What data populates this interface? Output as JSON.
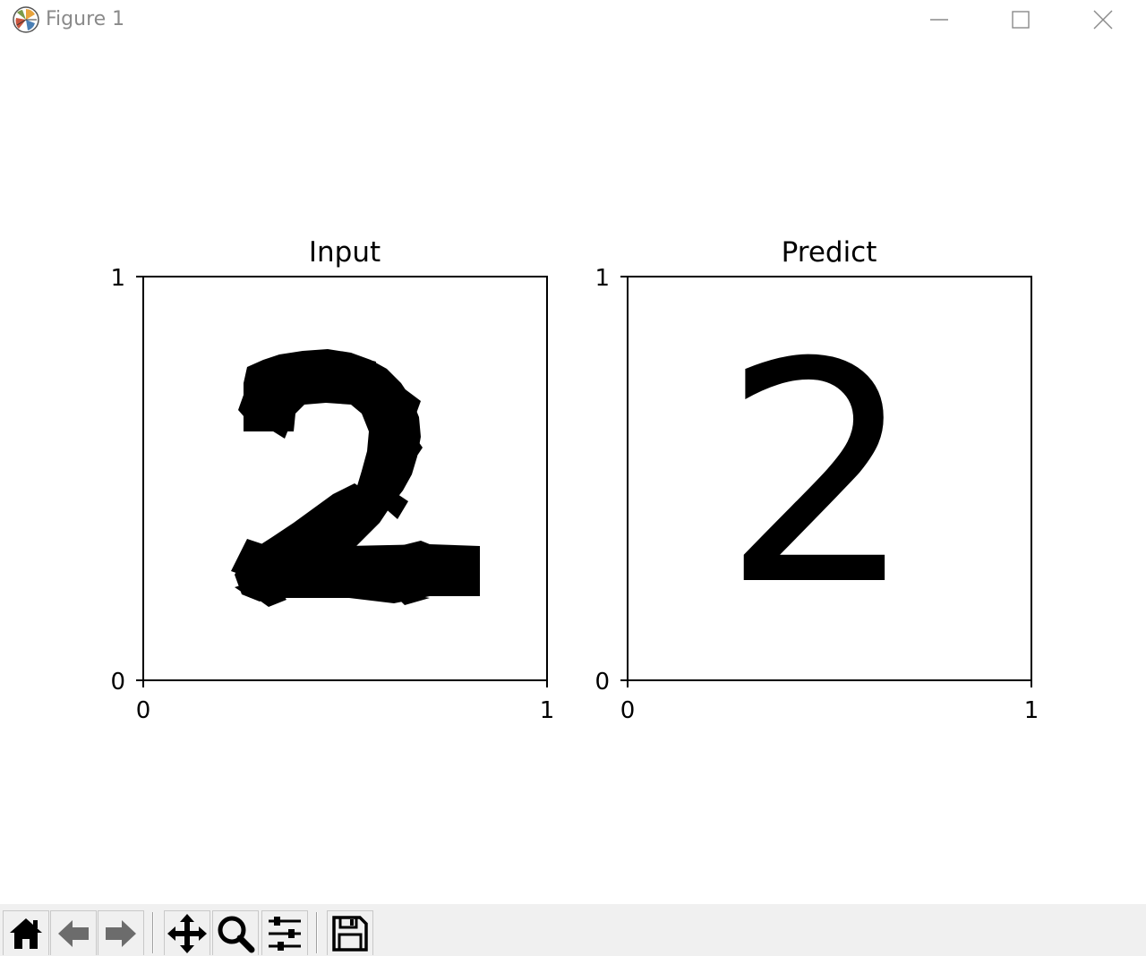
{
  "window": {
    "title": "Figure 1",
    "app_icon": "matplotlib-icon"
  },
  "figure": {
    "axes": [
      {
        "title": "Input",
        "x_ticks": [
          "0",
          "1"
        ],
        "y_ticks": [
          "0",
          "1"
        ],
        "content": "hand-drawn digit image"
      },
      {
        "title": "Predict",
        "x_ticks": [
          "0",
          "1"
        ],
        "y_ticks": [
          "0",
          "1"
        ],
        "content": "predicted digit text",
        "predicted_digit": "2"
      }
    ]
  },
  "toolbar": {
    "buttons": [
      {
        "name": "home-button",
        "icon": "home-icon"
      },
      {
        "name": "back-button",
        "icon": "left-arrow-icon"
      },
      {
        "name": "forward-button",
        "icon": "right-arrow-icon"
      },
      {
        "name": "pan-button",
        "icon": "move-icon"
      },
      {
        "name": "zoom-button",
        "icon": "magnifier-icon"
      },
      {
        "name": "configure-subplots-button",
        "icon": "sliders-icon"
      },
      {
        "name": "save-button",
        "icon": "floppy-disk-icon"
      }
    ]
  },
  "colors": {
    "ink": "#000000",
    "background": "#ffffff",
    "toolbar_bg": "#f0f0f0",
    "title_text": "#8a8a8a"
  }
}
